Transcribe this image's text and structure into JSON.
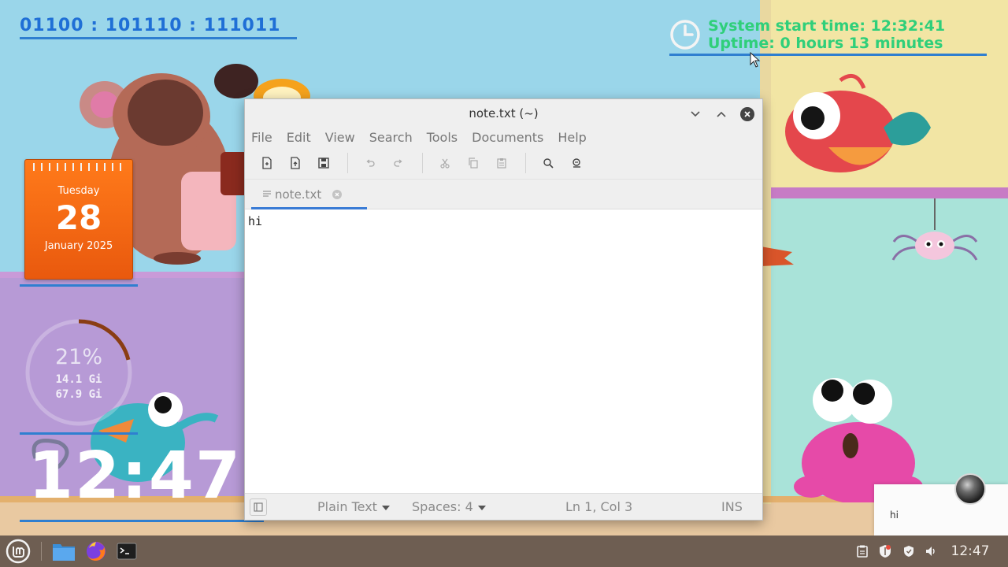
{
  "desktop": {
    "binary_clock": "01100 : 101110 : 111011",
    "system_info": {
      "start_time_label": "System start time:",
      "start_time": "12:32:41",
      "uptime_label": "Uptime:",
      "uptime": "0 hours 13 minutes"
    },
    "calendar": {
      "weekday": "Tuesday",
      "day": "28",
      "month_year": "January 2025"
    },
    "memory": {
      "percent": "21%",
      "used": "14.1 Gi",
      "total": "67.9 Gi",
      "fraction": 0.21
    },
    "big_time": "12:47"
  },
  "editor": {
    "title": "note.txt (~)",
    "menu": [
      "File",
      "Edit",
      "View",
      "Search",
      "Tools",
      "Documents",
      "Help"
    ],
    "tab_label": "note.txt",
    "content": "hi",
    "status": {
      "language": "Plain Text",
      "spaces": "Spaces: 4",
      "position": "Ln 1, Col 3",
      "mode": "INS"
    }
  },
  "notification": {
    "body": "hi"
  },
  "taskbar": {
    "time": "12:47"
  },
  "colors": {
    "accent_blue": "#2f7fd0",
    "uptime_green": "#2fcf7a",
    "calendar_orange": "#f26a12",
    "taskbar": "#6e5e52"
  }
}
